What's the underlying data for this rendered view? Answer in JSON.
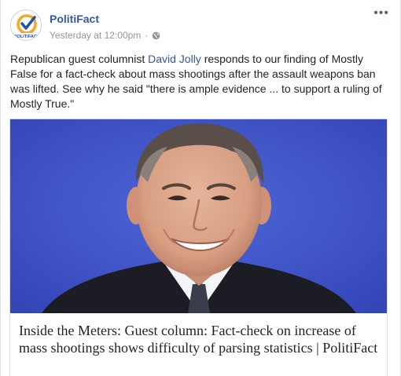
{
  "post": {
    "page_name": "PolitiFact",
    "timestamp": "Yesterday at 12:00pm",
    "separator": "·",
    "more_label": "•••",
    "text_before_link": "Republican guest columnist ",
    "link_text": "David Jolly",
    "text_after_link": " responds to our finding of Mostly False for a fact-check about mass shootings after the assault weapons ban was lifted. See why he said \"there is ample evidence ... to support a ruling of Mostly True.\""
  },
  "avatar": {
    "logo_text": "POLITIFACT",
    "icon": "politifact-logo-icon"
  },
  "attachment": {
    "headline": "Inside the Meters: Guest column: Fact-check on increase of mass shootings shows difficulty of parsing statistics | PolitiFact",
    "photo_subject": "man-in-suit-portrait"
  },
  "colors": {
    "link": "#365899",
    "meta": "#90949c",
    "photo_background": "#3f55c8",
    "logo_orange": "#f5a623",
    "logo_blue": "#2b4fa8"
  }
}
